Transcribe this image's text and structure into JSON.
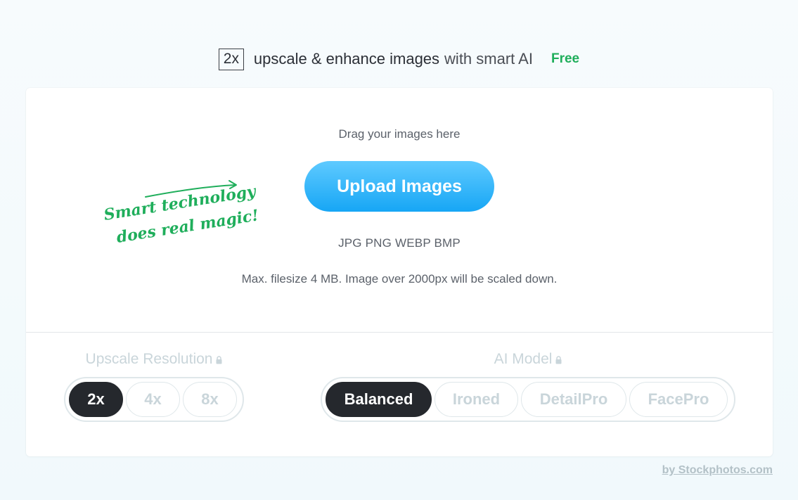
{
  "header": {
    "scale_badge": "2x",
    "title_strong": "upscale & enhance images",
    "title_light": "with smart AI",
    "free_label": "Free"
  },
  "upload": {
    "drag_text": "Drag your images here",
    "button_label": "Upload Images",
    "formats": "JPG PNG WEBP BMP",
    "limits": "Max. filesize 4 MB. Image over 2000px will be scaled down."
  },
  "annotation": {
    "line1": "Smart technology",
    "line2": "does real magic!"
  },
  "resolution": {
    "label": "Upscale Resolution",
    "options": [
      "2x",
      "4x",
      "8x"
    ],
    "selected": "2x"
  },
  "model": {
    "label": "AI Model",
    "options": [
      "Balanced",
      "Ironed",
      "DetailPro",
      "FacePro"
    ],
    "selected": "Balanced"
  },
  "footer": {
    "attribution": "by Stockphotos.com"
  },
  "colors": {
    "accent_blue": "#17a6f5",
    "free_green": "#1fae5b",
    "annotation_green": "#1fae5b",
    "active_pill": "#25282d",
    "disabled_text": "#c9d5da"
  }
}
